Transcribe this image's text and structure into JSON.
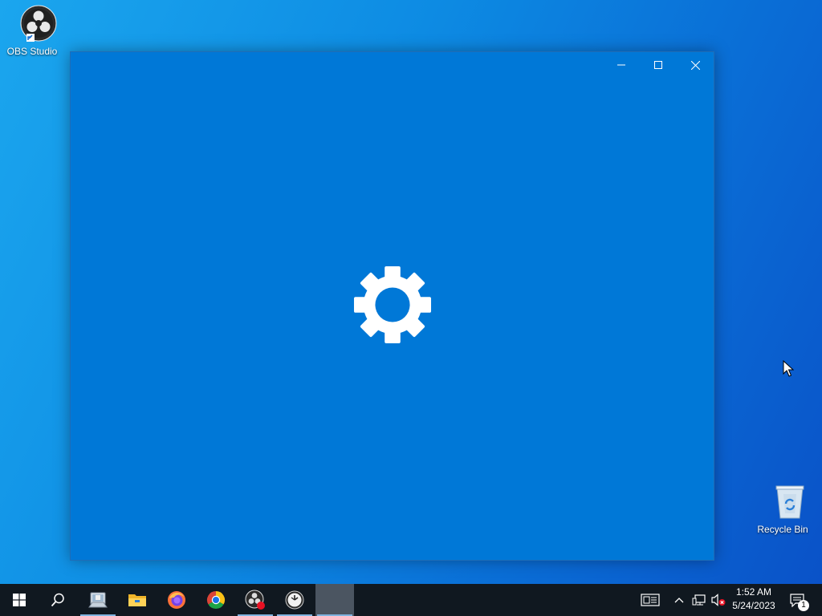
{
  "desktop": {
    "icons": [
      {
        "label": "OBS Studio",
        "icon": "obs-studio-icon"
      },
      {
        "label": "Recycle Bin",
        "icon": "recycle-bin-icon"
      }
    ]
  },
  "window": {
    "app": "Settings",
    "state": "loading splash",
    "controls": [
      "minimize",
      "maximize",
      "close"
    ],
    "accent_color": "#0078d7"
  },
  "taskbar": {
    "pinned": [
      "start-icon",
      "search-icon",
      "file-manager-icon",
      "file-explorer-icon",
      "firefox-icon",
      "chrome-icon",
      "obs-studio-icon",
      "clock-app-icon",
      "settings-active-slot"
    ],
    "clock": {
      "time": "1:52 AM",
      "date": "5/24/2023"
    },
    "notification_count": "1"
  },
  "colors": {
    "taskbar": "#101820",
    "window": "#0078d7",
    "desktop_left": "#1ba6ee",
    "desktop_right": "#0a52c8"
  }
}
